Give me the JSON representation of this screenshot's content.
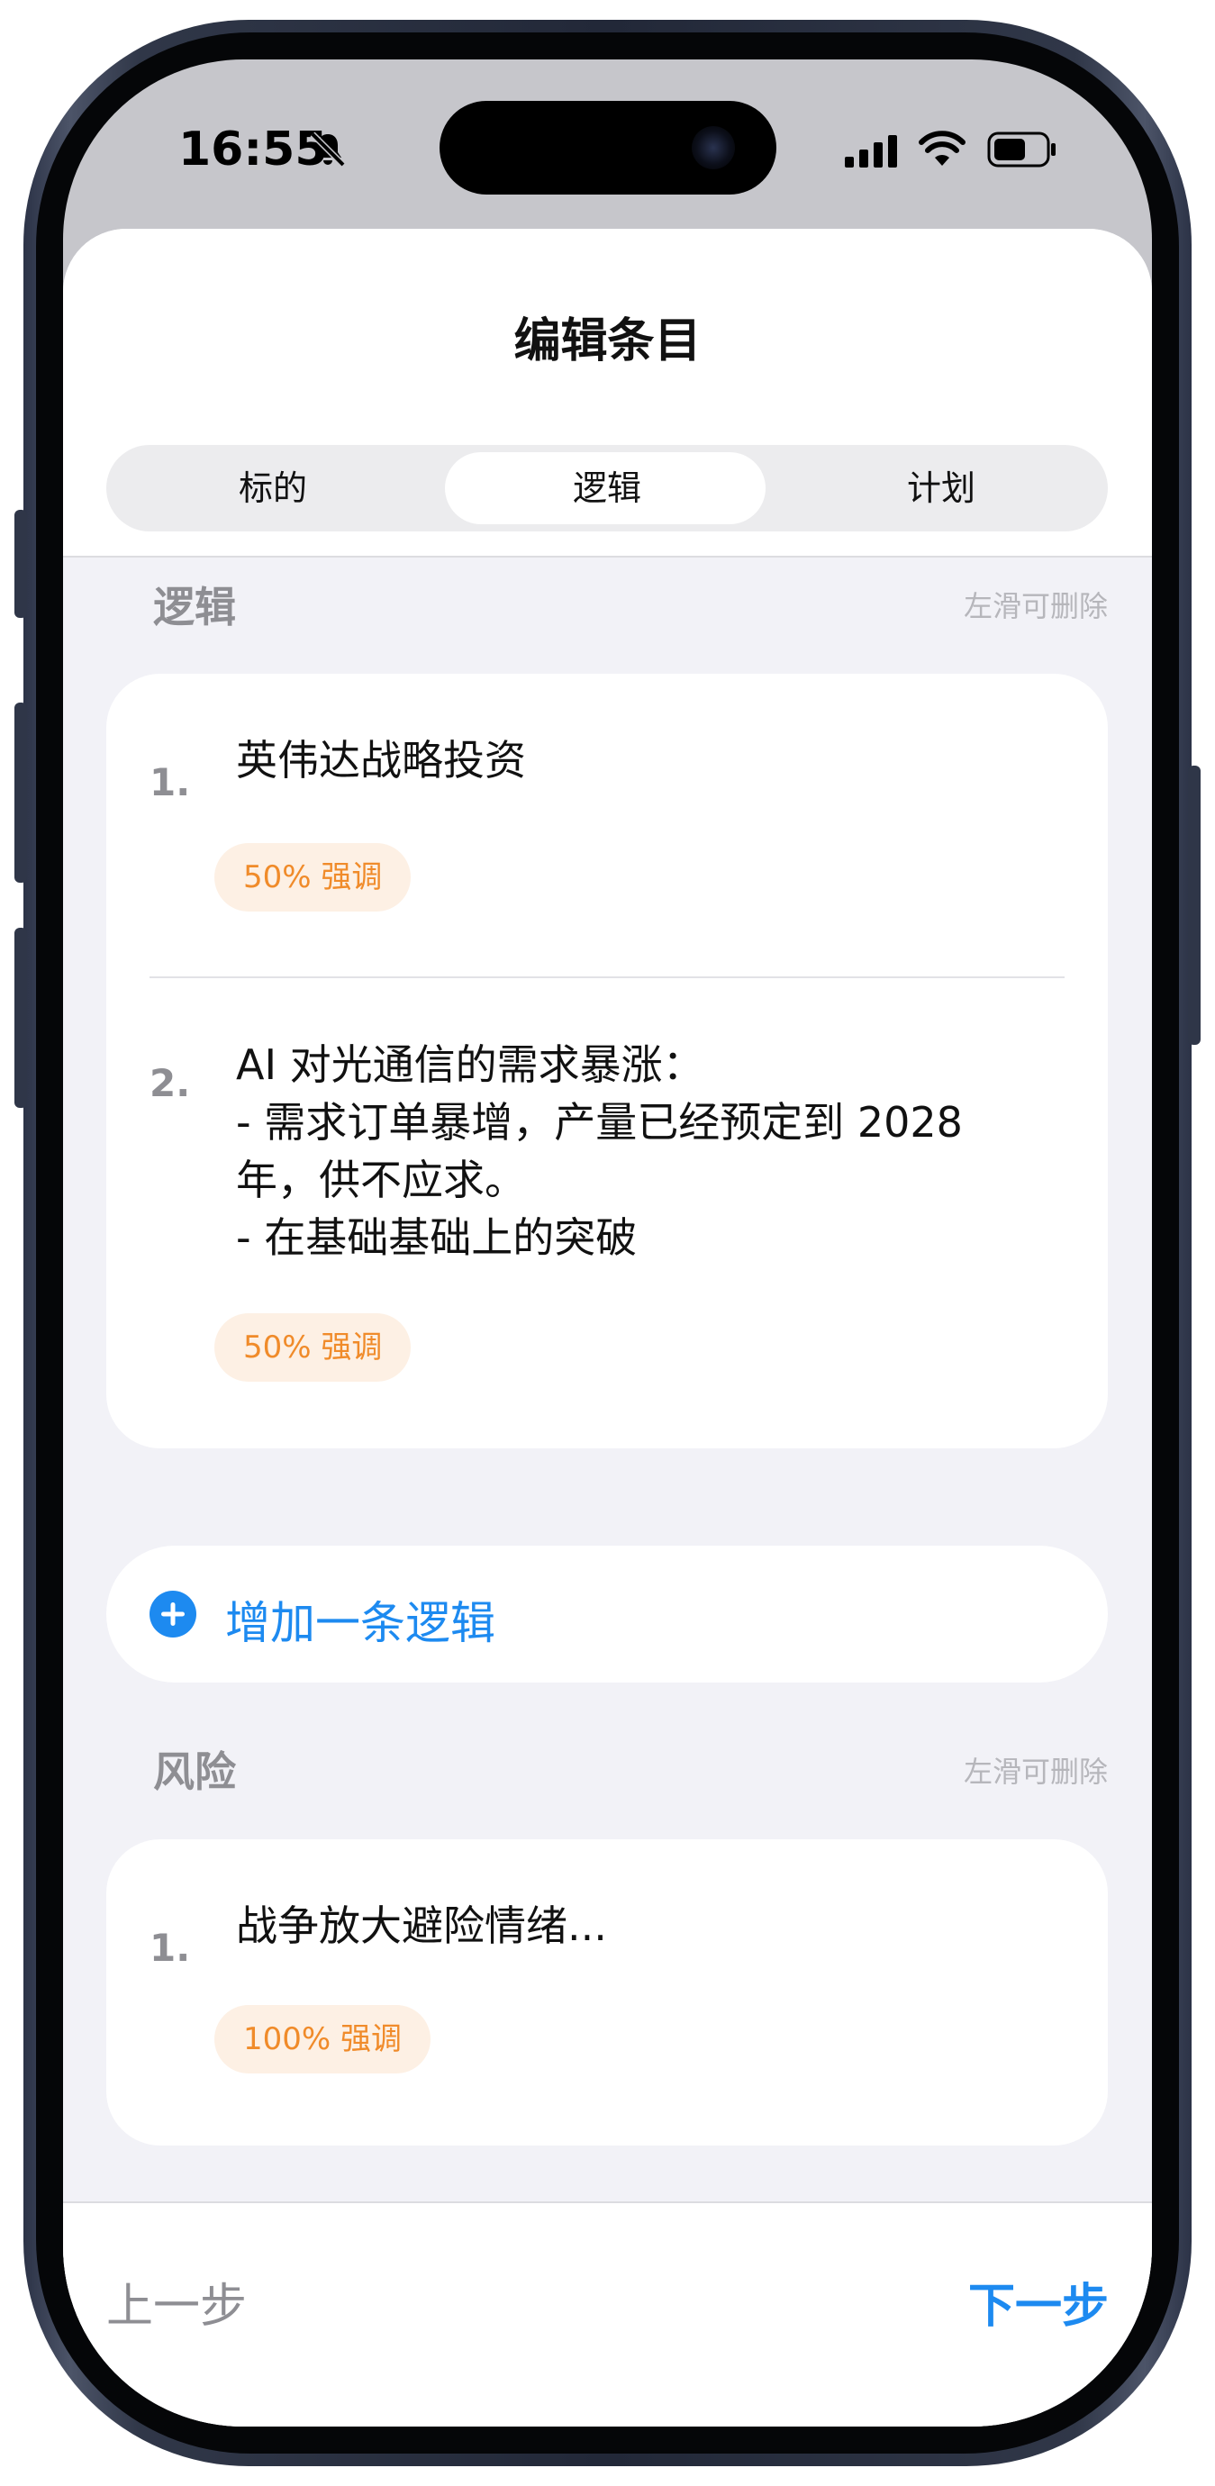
{
  "status_bar": {
    "time": "16:55",
    "icons": [
      "bell-slash-icon",
      "cellular-signal-icon",
      "wifi-icon",
      "battery-icon"
    ]
  },
  "sheet": {
    "title": "编辑条目"
  },
  "tabs": [
    {
      "label": "标的",
      "active": false
    },
    {
      "label": "逻辑",
      "active": true
    },
    {
      "label": "计划",
      "active": false
    }
  ],
  "logic_section": {
    "title": "逻辑",
    "hint": "左滑可删除",
    "items": [
      {
        "number": "1.",
        "text": "英伟达战略投资",
        "tag": "50%  强调"
      },
      {
        "number": "2.",
        "text": "AI 对光通信的需求暴涨：\n- 需求订单暴增，产量已经预定到 2028\n年，供不应求。\n- 在基础基础上的突破",
        "tag": "50%  强调"
      }
    ],
    "add_label": "增加一条逻辑"
  },
  "risk_section": {
    "title": "风险",
    "hint": "左滑可删除",
    "items": [
      {
        "number": "1.",
        "text": "战争放大避险情绪...",
        "tag": "100%  强调"
      }
    ]
  },
  "footer": {
    "prev_label": "上一步",
    "next_label": "下一步"
  },
  "colors": {
    "accent": "#1d8af0",
    "tag_text": "#f08b2a",
    "tag_bg": "#fdf0e4"
  }
}
